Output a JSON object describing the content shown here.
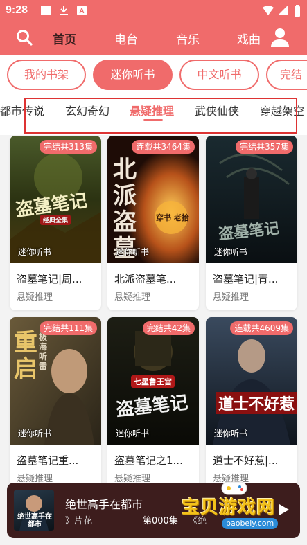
{
  "status_bar": {
    "time": "9:28"
  },
  "top_nav": {
    "tabs": [
      {
        "label": "首页",
        "active": true
      },
      {
        "label": "电台",
        "active": false
      },
      {
        "label": "音乐",
        "active": false
      },
      {
        "label": "戏曲",
        "active": false
      }
    ]
  },
  "pills": [
    {
      "label": "我的书架",
      "active": false
    },
    {
      "label": "迷你听书",
      "active": true
    },
    {
      "label": "中文听书",
      "active": false
    },
    {
      "label": "完结",
      "active": false
    }
  ],
  "subtabs": [
    {
      "label": "都市传说",
      "active": false
    },
    {
      "label": "玄幻奇幻",
      "active": false
    },
    {
      "label": "悬疑推理",
      "active": true
    },
    {
      "label": "武侠仙侠",
      "active": false
    },
    {
      "label": "穿越架空",
      "active": false
    }
  ],
  "books": [
    {
      "badge": "完结共313集",
      "source": "迷你听书",
      "title": "盗墓笔记|周...",
      "category": "悬疑推理",
      "cover_text": "盗墓笔记",
      "cover_sub": "经典全集"
    },
    {
      "badge": "连载共3464集",
      "source": "迷你听书",
      "title": "北派盗墓笔...",
      "category": "悬疑推理",
      "cover_text": "北派盗墓",
      "cover_sub": "穿书 老拾"
    },
    {
      "badge": "完结共357集",
      "source": "迷你听书",
      "title": "盗墓笔记|青...",
      "category": "悬疑推理",
      "cover_text": "盗墓笔记",
      "cover_sub": ""
    },
    {
      "badge": "完结共111集",
      "source": "迷你听书",
      "title": "盗墓笔记重...",
      "category": "悬疑推理",
      "cover_text": "重启",
      "cover_sub": "极海听雷"
    },
    {
      "badge": "完结共42集",
      "source": "迷你听书",
      "title": "盗墓笔记之1...",
      "category": "悬疑推理",
      "cover_text": "盗墓笔记",
      "cover_sub": "七星鲁王宫"
    },
    {
      "badge": "连载共4609集",
      "source": "迷你听书",
      "title": "道士不好惹|...",
      "category": "悬疑推理",
      "cover_text": "道士不好惹",
      "cover_sub": ""
    }
  ],
  "player": {
    "title": "绝世高手在都市",
    "note": "》片花",
    "episode": "第000集",
    "extra": "《绝",
    "thumb_text": "绝世高手在都市"
  },
  "watermark": {
    "title": "宝贝游戏网",
    "url": "baobeiy.com"
  },
  "colors": {
    "accent": "#f06b6b",
    "player_bg": "#3d1d1d"
  }
}
